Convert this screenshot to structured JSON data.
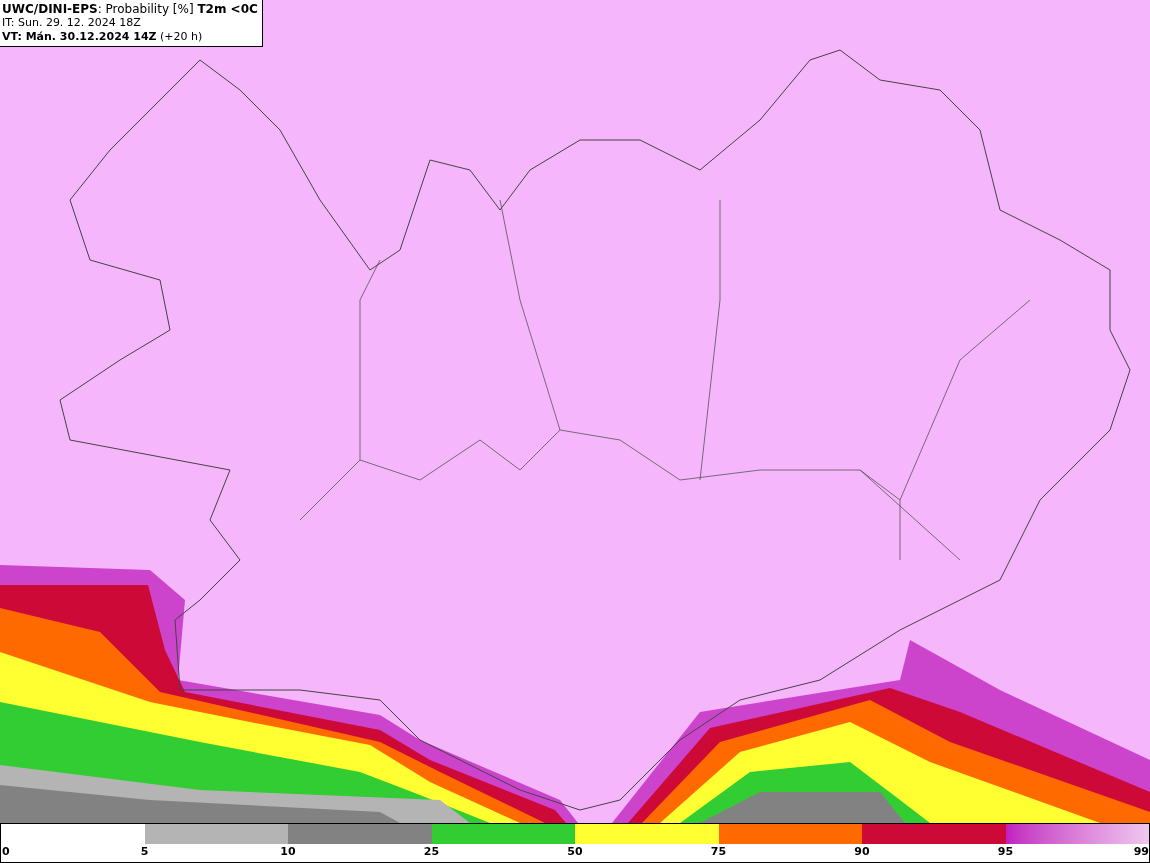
{
  "header": {
    "title": "**UWC/DINI-EPS**: Probability [%] **T2m <0C**",
    "init_time": "IT: Sun. 29. 12. 2024 18Z",
    "valid_time": "**VT: Mán. 30.12.2024 14Z** (+20 h)"
  },
  "legend": {
    "start_label": "0",
    "segments": [
      {
        "label": "5"
      },
      {
        "color": "#b4b4b4",
        "label": "10"
      },
      {
        "color": "#828282",
        "label": "25"
      },
      {
        "color": "#32cd32",
        "label": "50"
      },
      {
        "color": "#ffff32",
        "label": "75"
      },
      {
        "color": "#ff6a00",
        "label": "90"
      },
      {
        "color": "#cd0a37",
        "label": "95"
      },
      {
        "color": "#c01fc0",
        "label": "99"
      }
    ]
  }
}
